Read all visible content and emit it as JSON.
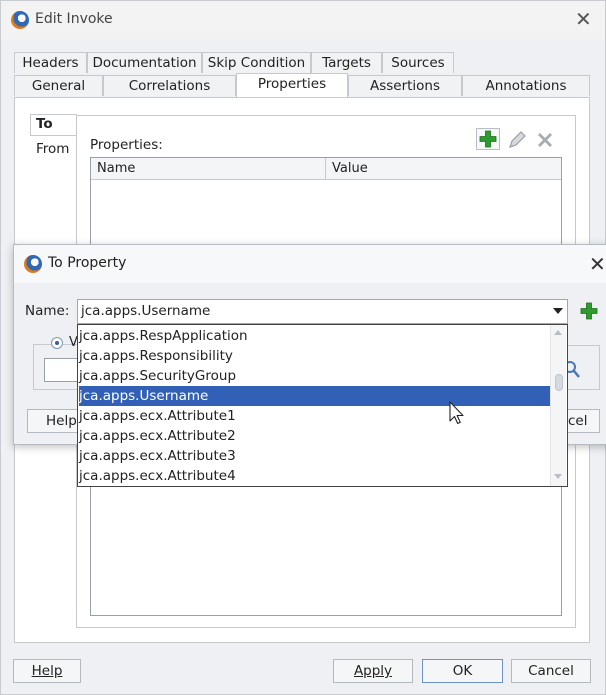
{
  "outer": {
    "title": "Edit Invoke",
    "tabs_row1": [
      "Headers",
      "Documentation",
      "Skip Condition",
      "Targets",
      "Sources"
    ],
    "tabs_row2": [
      "General",
      "Correlations",
      "Properties",
      "Assertions",
      "Annotations"
    ],
    "selected_tab": "Properties",
    "side_tabs": [
      "To",
      "From"
    ],
    "properties_label": "Properties:",
    "columns": [
      "Name",
      "Value"
    ],
    "buttons": {
      "help": "Help",
      "apply": "Apply",
      "ok": "OK",
      "cancel": "Cancel"
    }
  },
  "inner": {
    "title": "To Property",
    "name_label": "Name:",
    "name_value": "jca.apps.Username",
    "help_partial": "Help",
    "cancel_partial": "cel",
    "radio_partial": "V",
    "options": [
      "jca.apps.RespApplication",
      "jca.apps.Responsibility",
      "jca.apps.SecurityGroup",
      "jca.apps.Username",
      "jca.apps.ecx.Attribute1",
      "jca.apps.ecx.Attribute2",
      "jca.apps.ecx.Attribute3",
      "jca.apps.ecx.Attribute4"
    ],
    "selected_option": "jca.apps.Username"
  },
  "colors": {
    "accent_green": "#2f9a2f",
    "selection": "#3260b6",
    "focus_border": "#e89a35"
  }
}
